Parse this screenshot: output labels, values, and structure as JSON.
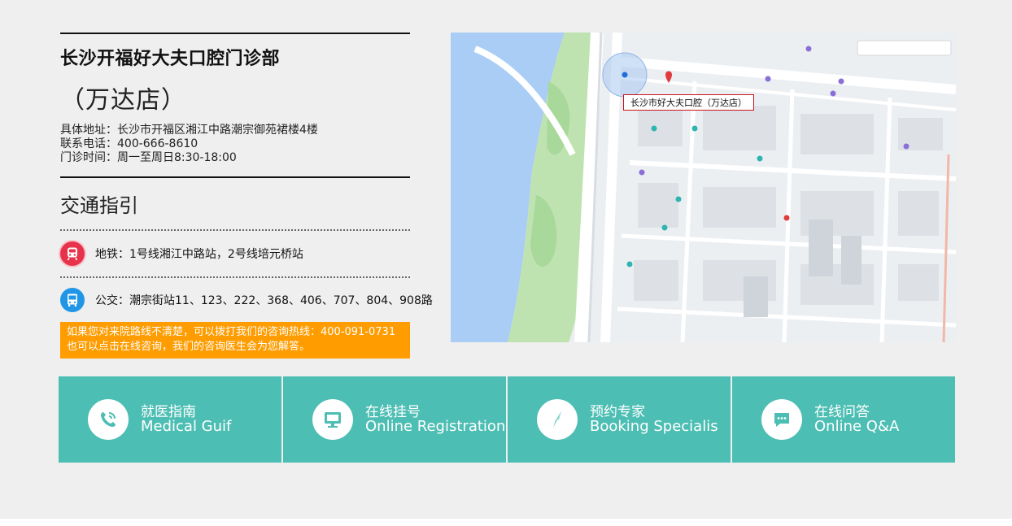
{
  "clinic": {
    "name": "长沙开福好大夫口腔门诊部",
    "branch": "（万达店）",
    "address": "具体地址：长沙市开福区湘江中路潮宗御苑裙楼4楼",
    "phone": "联系电话：400-666-8610",
    "hours": "门诊时间：周一至周日8:30-18:00"
  },
  "traffic": {
    "title": "交通指引",
    "subway": "地铁：1号线湘江中路站，2号线培元桥站",
    "bus": "公交：潮宗街站11、123、222、368、406、707、804、908路",
    "notice_line1": "如果您对来院路线不清楚，可以拨打我们的咨询热线：400-091-0731",
    "notice_line2": "也可以点击在线咨询，我们的咨询医生会为您解答。"
  },
  "map": {
    "pin_label": "长沙市好大夫口腔（万达店）"
  },
  "actions": [
    {
      "cn": "就医指南",
      "en": "Medical Guif",
      "icon": "phone-icon"
    },
    {
      "cn": "在线挂号",
      "en": "Online Registration",
      "icon": "monitor-icon"
    },
    {
      "cn": "预约专家",
      "en": "Booking Specialis",
      "icon": "compass-icon"
    },
    {
      "cn": "在线问答",
      "en": "Online Q&A",
      "icon": "chat-icon"
    }
  ],
  "colors": {
    "accent_teal": "#4dbeb3",
    "notice_orange": "#ff9c00",
    "subway_red": "#e6334b",
    "bus_blue": "#2196e6"
  }
}
